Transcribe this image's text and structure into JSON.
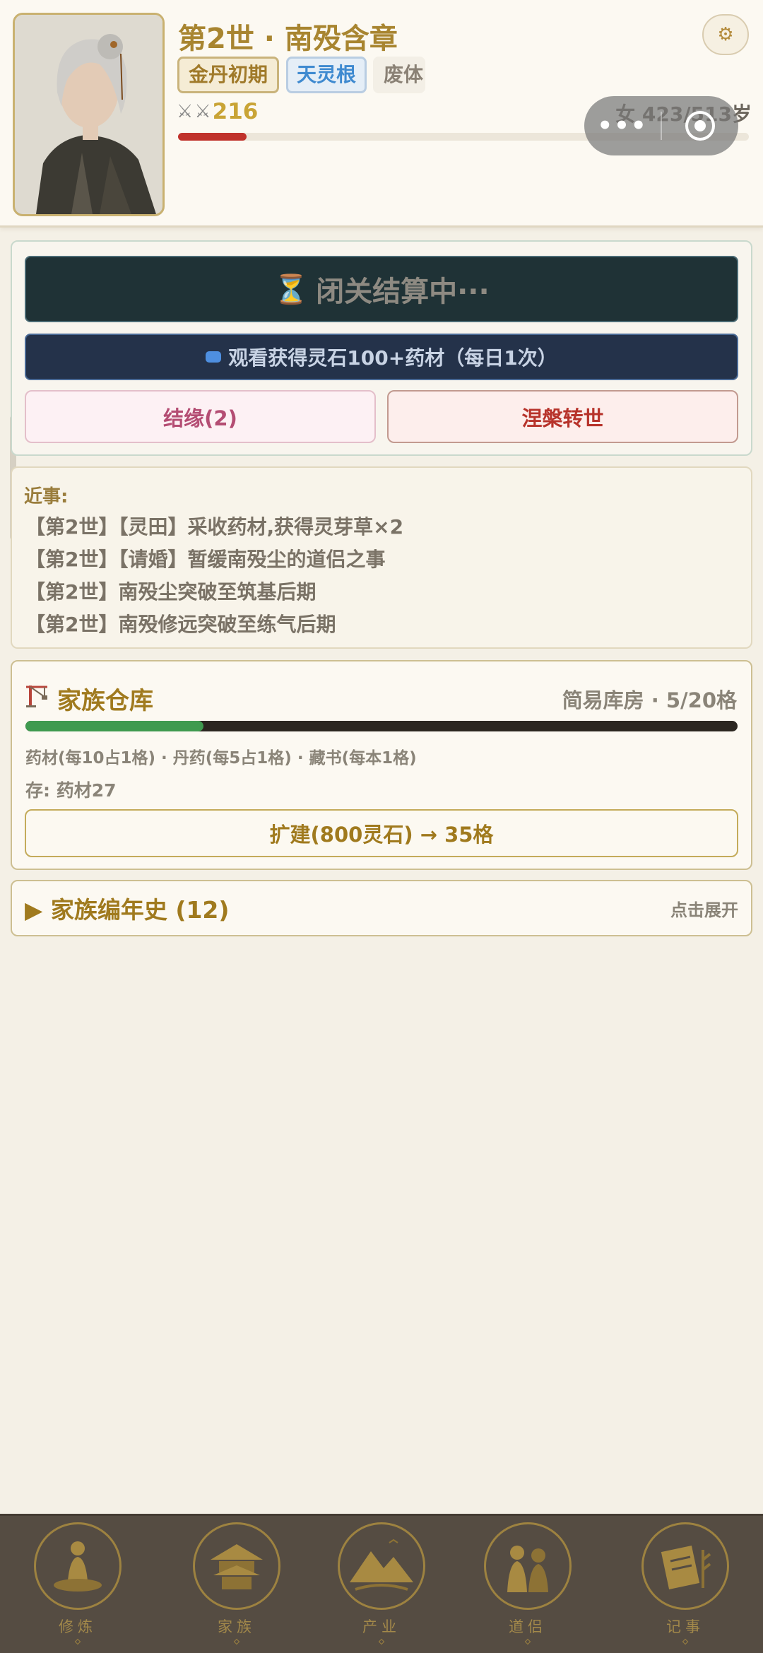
{
  "header": {
    "title": "第2世 · 南殁含章",
    "realm": "金丹初期",
    "root": "天灵根",
    "body": "废体",
    "power": "216",
    "age": "女 423/513岁",
    "life_fraction": 0.12,
    "capsule_more": "•••"
  },
  "actions": {
    "closed_label": "闭关结算中···",
    "closed_icon": "hourglass-icon",
    "ad_label": "观看获得灵石100+药材（每日1次）",
    "marry_label": "结缘(2)",
    "reborn_label": "涅槃转世"
  },
  "recent": {
    "label": "近事:",
    "events": [
      "【第2世】【灵田】采收药材,获得灵芽草×2",
      "【第2世】【请婚】暂缓南殁尘的道侣之事",
      "【第2世】南殁尘突破至筑基后期",
      "【第2世】南殁修远突破至练气后期"
    ]
  },
  "warehouse": {
    "title": "家族仓库",
    "info": "简易库房 · 5/20格",
    "fill_fraction": 0.25,
    "rules": "药材(每10占1格) · 丹药(每5占1格) · 藏书(每本1格)",
    "stock": "存: 药材27",
    "expand_label": "扩建(800灵石) → 35格"
  },
  "chronicle": {
    "title": "▶ 家族编年史 (12)",
    "hint": "点击展开"
  },
  "nav": {
    "items": [
      {
        "label": "修炼",
        "icon": "meditation-icon"
      },
      {
        "label": "家族",
        "icon": "pavilion-icon"
      },
      {
        "label": "产业",
        "icon": "mountain-icon"
      },
      {
        "label": "道侣",
        "icon": "couple-icon"
      },
      {
        "label": "记事",
        "icon": "scroll-icon"
      }
    ]
  },
  "colors": {
    "gold": "#a88530",
    "life_bar": "#c0322b",
    "ware_bar": "#3f9a4f",
    "nav_bg": "#554c42"
  }
}
